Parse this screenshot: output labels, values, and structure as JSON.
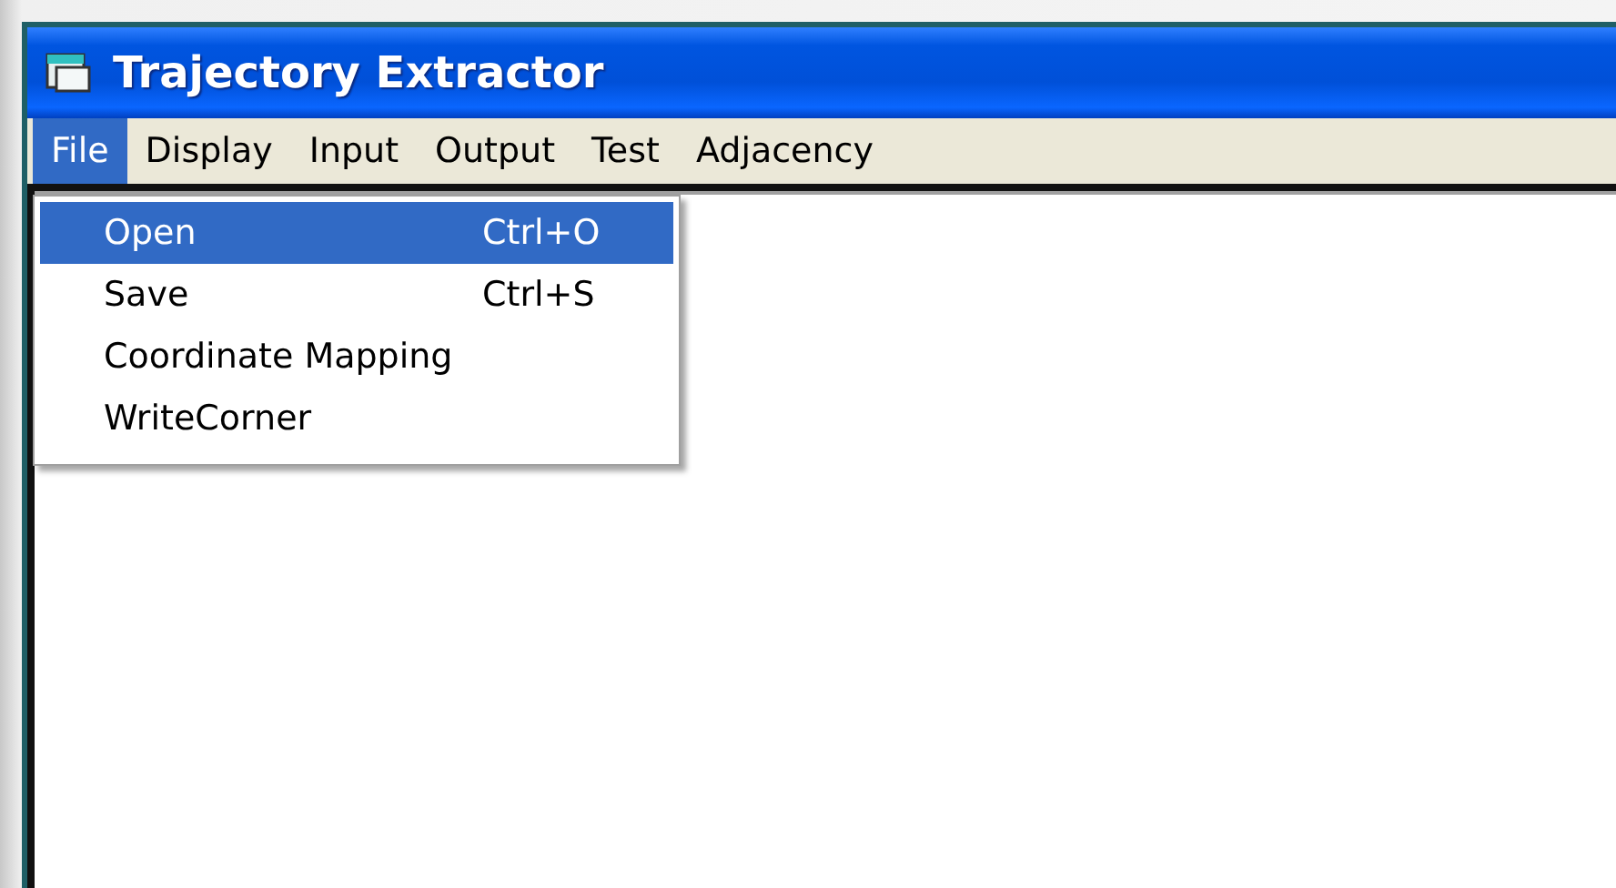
{
  "window": {
    "title": "Trajectory Extractor"
  },
  "menubar": [
    {
      "label": "File",
      "selected": true
    },
    {
      "label": "Display",
      "selected": false
    },
    {
      "label": "Input",
      "selected": false
    },
    {
      "label": "Output",
      "selected": false
    },
    {
      "label": "Test",
      "selected": false
    },
    {
      "label": "Adjacency",
      "selected": false
    }
  ],
  "file_menu": [
    {
      "label": "Open",
      "shortcut": "Ctrl+O",
      "selected": true
    },
    {
      "label": "Save",
      "shortcut": "Ctrl+S",
      "selected": false
    },
    {
      "label": "Coordinate Mapping",
      "selected": false
    },
    {
      "label": "WriteCorner",
      "selected": false
    }
  ]
}
